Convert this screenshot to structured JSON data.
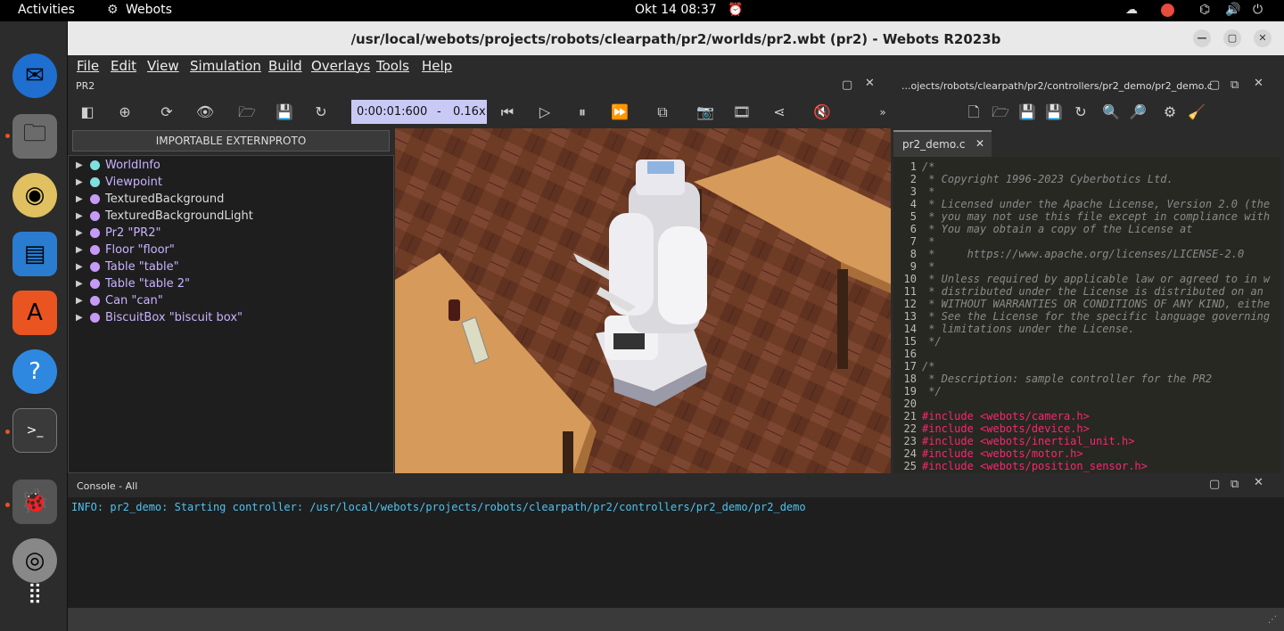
{
  "topbar": {
    "activities": "Activities",
    "app": "Webots",
    "datetime": "Okt 14  08:37"
  },
  "window": {
    "title": "/usr/local/webots/projects/robots/clearpath/pr2/worlds/pr2.wbt (pr2) - Webots R2023b"
  },
  "menu": [
    "File",
    "Edit",
    "View",
    "Simulation",
    "Build",
    "Overlays",
    "Tools",
    "Help"
  ],
  "scene": {
    "panel_title": "PR2",
    "import_label": "IMPORTABLE EXTERNPROTO",
    "time": "0:00:01:600",
    "separator": "-",
    "speed": "0.16x",
    "nodes": [
      {
        "label": "WorldInfo",
        "color": "#7fe0e0"
      },
      {
        "label": "Viewpoint",
        "color": "#7fe0e0"
      },
      {
        "label": "TexturedBackground",
        "color": "#c79af7"
      },
      {
        "label": "TexturedBackgroundLight",
        "color": "#c79af7"
      },
      {
        "label": "Pr2 \"PR2\"",
        "color": "#c79af7"
      },
      {
        "label": "Floor \"floor\"",
        "color": "#c79af7"
      },
      {
        "label": "Table \"table\"",
        "color": "#c79af7"
      },
      {
        "label": "Table \"table 2\"",
        "color": "#c79af7"
      },
      {
        "label": "Can \"can\"",
        "color": "#c79af7"
      },
      {
        "label": "BiscuitBox \"biscuit box\"",
        "color": "#c79af7"
      }
    ]
  },
  "editor": {
    "path": "...ojects/robots/clearpath/pr2/controllers/pr2_demo/pr2_demo.c",
    "tab": "pr2_demo.c",
    "lines": [
      "/*",
      " * Copyright 1996-2023 Cyberbotics Ltd.",
      " *",
      " * Licensed under the Apache License, Version 2.0 (the",
      " * you may not use this file except in compliance with",
      " * You may obtain a copy of the License at",
      " *",
      " *     https://www.apache.org/licenses/LICENSE-2.0",
      " *",
      " * Unless required by applicable law or agreed to in w",
      " * distributed under the License is distributed on an",
      " * WITHOUT WARRANTIES OR CONDITIONS OF ANY KIND, eithe",
      " * See the License for the specific language governing",
      " * limitations under the License.",
      " */",
      "",
      "/*",
      " * Description: sample controller for the PR2",
      " */",
      "",
      "#include <webots/camera.h>",
      "#include <webots/device.h>",
      "#include <webots/inertial_unit.h>",
      "#include <webots/motor.h>",
      "#include <webots/position_sensor.h>"
    ]
  },
  "console": {
    "title": "Console - All",
    "message": "INFO: pr2_demo: Starting controller: /usr/local/webots/projects/robots/clearpath/pr2/controllers/pr2_demo/pr2_demo"
  }
}
